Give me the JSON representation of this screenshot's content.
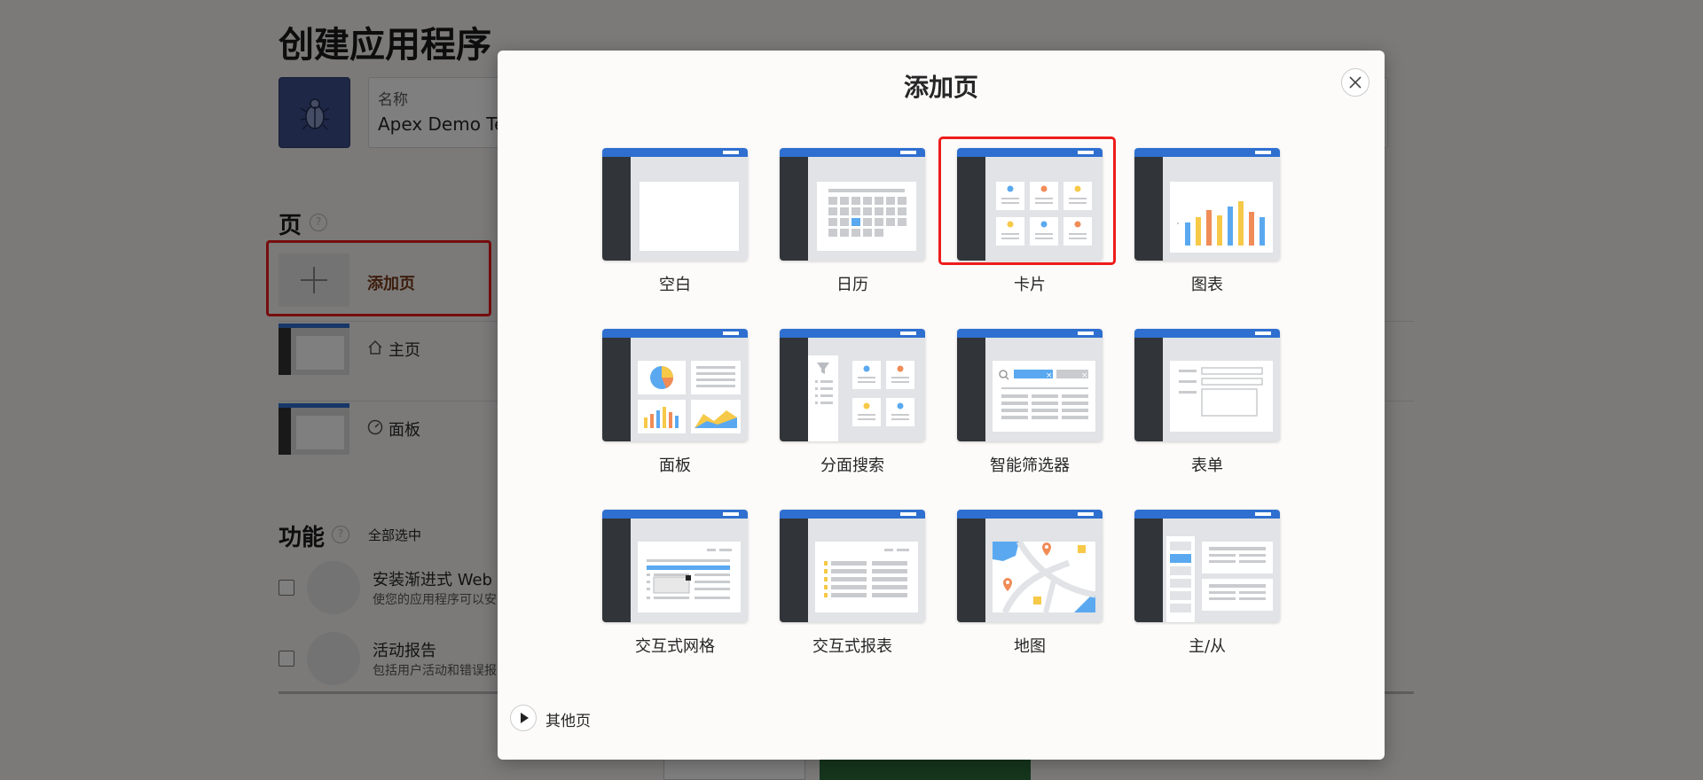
{
  "page": {
    "title": "创建应用程序",
    "name_field": {
      "label": "名称",
      "value": "Apex Demo Tes"
    },
    "pages_section": {
      "title": "页",
      "help": "?",
      "add_page_label": "添加页"
    },
    "page_rows": [
      {
        "icon": "home-icon",
        "label": "主页"
      },
      {
        "icon": "dashboard-icon",
        "label": "面板"
      }
    ],
    "features_section": {
      "title": "功能",
      "help": "?",
      "select_all": "全部选中"
    },
    "features": [
      {
        "icon": "package-icon",
        "title": "安装渐进式 Web 应",
        "desc": "使您的应用程序可以安"
      },
      {
        "icon": "user-activity-icon",
        "title": "活动报告",
        "desc": "包括用户活动和错误报"
      }
    ]
  },
  "modal": {
    "title": "添加页",
    "close_icon": "close-icon",
    "cards": [
      {
        "id": "blank",
        "label": "空白"
      },
      {
        "id": "calendar",
        "label": "日历"
      },
      {
        "id": "cards",
        "label": "卡片"
      },
      {
        "id": "chart",
        "label": "图表"
      },
      {
        "id": "dashboard",
        "label": "面板"
      },
      {
        "id": "faceted-search",
        "label": "分面搜索"
      },
      {
        "id": "smart-filters",
        "label": "智能筛选器"
      },
      {
        "id": "form",
        "label": "表单"
      },
      {
        "id": "interactive-grid",
        "label": "交互式网格"
      },
      {
        "id": "interactive-report",
        "label": "交互式报表"
      },
      {
        "id": "map",
        "label": "地图"
      },
      {
        "id": "master-detail",
        "label": "主/从"
      }
    ],
    "others_label": "其他页",
    "selected": "cards"
  },
  "colors": {
    "header_blue": "#2e6fd0",
    "sidebar_dark": "#313539",
    "highlight_red": "#ee1c1c",
    "accent_orange": "#f08c57",
    "accent_yellow": "#f7c948",
    "accent_blue": "#5aa9f0"
  }
}
